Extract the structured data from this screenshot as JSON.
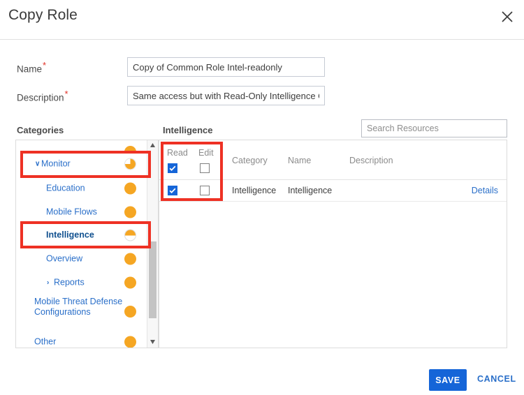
{
  "dialog": {
    "title": "Copy Role",
    "close_icon": "close-icon"
  },
  "form": {
    "name": {
      "label": "Name",
      "required_marker": "*",
      "value": "Copy of Common Role Intel-readonly",
      "placeholder": ""
    },
    "description": {
      "label": "Description",
      "required_marker": "*",
      "value": "Same access but with Read-Only Intelligence Opt-In",
      "placeholder": ""
    }
  },
  "sections": {
    "categories_label": "Categories",
    "resource_label": "Intelligence"
  },
  "search": {
    "placeholder": "Search Resources",
    "value": ""
  },
  "tree": {
    "partial_top_item": "",
    "items": [
      {
        "label": "Monitor",
        "level": 0,
        "caret": "∨",
        "indicator": "three-quarter",
        "selected": false
      },
      {
        "label": "Education",
        "level": 1,
        "caret": "",
        "indicator": "full",
        "selected": false
      },
      {
        "label": "Mobile Flows",
        "level": 1,
        "caret": "",
        "indicator": "full",
        "selected": false
      },
      {
        "label": "Intelligence",
        "level": 1,
        "caret": "",
        "indicator": "half",
        "selected": true
      },
      {
        "label": "Overview",
        "level": 1,
        "caret": "",
        "indicator": "full",
        "selected": false
      },
      {
        "label": "Reports",
        "level": 1,
        "caret": "›",
        "indicator": "full",
        "selected": false
      },
      {
        "label": "Mobile Threat Defense Configurations",
        "level": 0,
        "caret": "",
        "indicator": "full",
        "selected": false
      },
      {
        "label": "Other",
        "level": 0,
        "caret": "",
        "indicator": "full",
        "selected": false
      }
    ],
    "scrollbar": {
      "up_icon": "caret-up-icon",
      "down_icon": "caret-down-icon"
    }
  },
  "table": {
    "headers": {
      "read": "Read",
      "edit": "Edit",
      "category": "Category",
      "name": "Name",
      "description": "Description"
    },
    "header_checkboxes": {
      "read_checked": true,
      "edit_checked": false
    },
    "rows": [
      {
        "read_checked": true,
        "edit_checked": false,
        "category": "Intelligence",
        "name": "Intelligence",
        "description": "",
        "details_link": "Details"
      }
    ]
  },
  "footer": {
    "save_label": "SAVE",
    "cancel_label": "CANCEL"
  },
  "colors": {
    "accent_blue": "#1565d8",
    "link_blue": "#2a6fc9",
    "annotation_red": "#ee3124",
    "indicator_orange": "#f5a623",
    "required_red": "#e03127"
  }
}
